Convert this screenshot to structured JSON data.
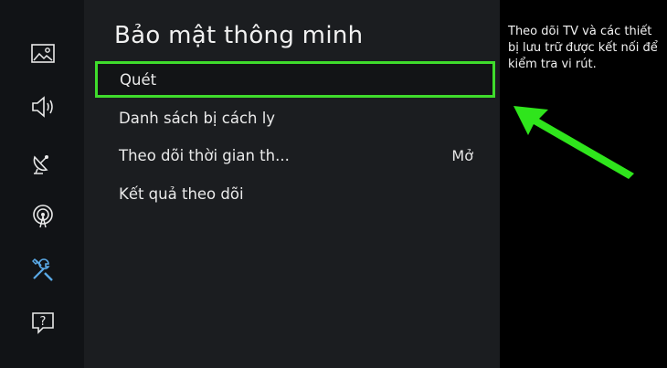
{
  "sidebar": {
    "icons": [
      {
        "name": "picture-icon"
      },
      {
        "name": "sound-icon"
      },
      {
        "name": "broadcasting-icon"
      },
      {
        "name": "network-icon"
      },
      {
        "name": "support-icon",
        "active": true
      },
      {
        "name": "help-icon"
      }
    ]
  },
  "panel": {
    "title": "Bảo mật thông minh",
    "items": [
      {
        "label": "Quét",
        "value": "",
        "selected": true
      },
      {
        "label": "Danh sách bị cách ly",
        "value": ""
      },
      {
        "label": "Theo dõi thời gian th...",
        "value": "Mở"
      },
      {
        "label": "Kết quả theo dõi",
        "value": ""
      }
    ]
  },
  "help": {
    "text": "Theo dõi TV và các thiết bị lưu trữ được kết nối để kiểm tra vi rút."
  },
  "colors": {
    "highlight": "#3fdc2c",
    "arrow": "#2fe51c",
    "active_icon": "#5aa9e6",
    "icon": "#e9e9e9"
  }
}
